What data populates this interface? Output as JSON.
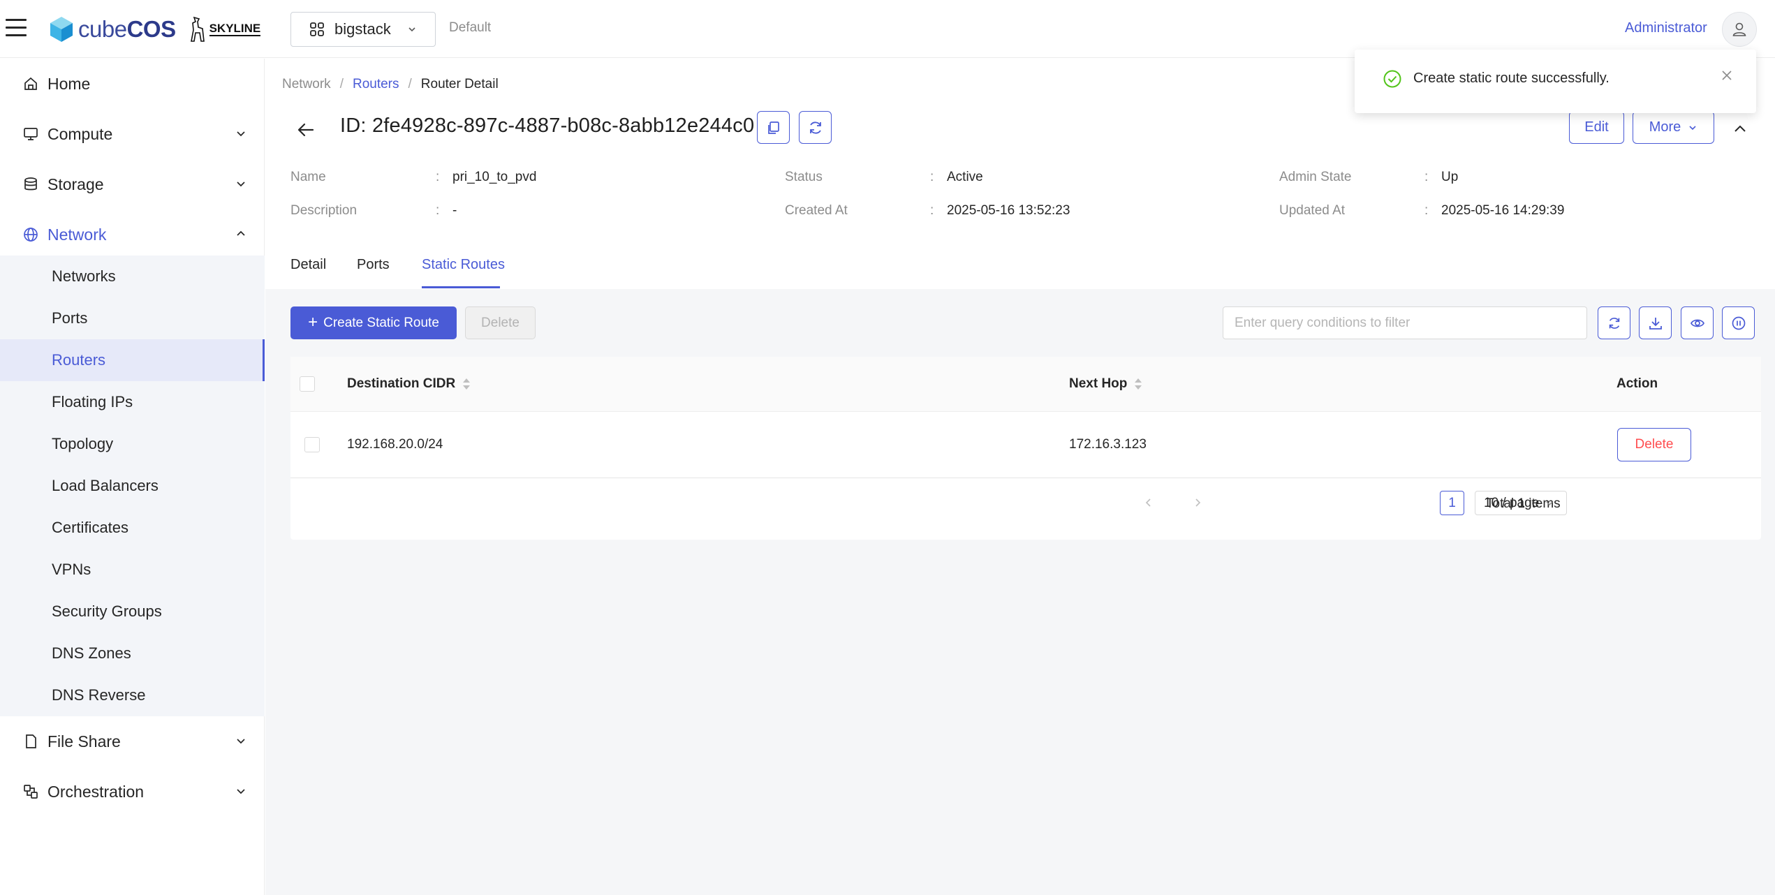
{
  "header": {
    "brand_name_light": "cube",
    "brand_name_bold": "COS",
    "partner_logo_text": "SKYLINE",
    "project": "bigstack",
    "domain": "Default",
    "user": "Administrator"
  },
  "sidebar": {
    "items": [
      {
        "label": "Home",
        "icon": "home-icon"
      },
      {
        "label": "Compute",
        "icon": "monitor-icon"
      },
      {
        "label": "Storage",
        "icon": "database-icon"
      },
      {
        "label": "Network",
        "icon": "globe-icon"
      },
      {
        "label": "File Share",
        "icon": "file-icon"
      },
      {
        "label": "Orchestration",
        "icon": "orchestration-icon"
      }
    ],
    "network_sub": [
      "Networks",
      "Ports",
      "Routers",
      "Floating IPs",
      "Topology",
      "Load Balancers",
      "Certificates",
      "VPNs",
      "Security Groups",
      "DNS Zones",
      "DNS Reverse"
    ]
  },
  "breadcrumb": {
    "items": [
      "Network",
      "Routers",
      "Router Detail"
    ]
  },
  "detail": {
    "id_label": "ID:",
    "id_value": "2fe4928c-897c-4887-b08c-8abb12e244c0",
    "edit_label": "Edit",
    "more_label": "More",
    "fields": [
      {
        "label": "Name",
        "value": "pri_10_to_pvd"
      },
      {
        "label": "Description",
        "value": "-"
      },
      {
        "label": "Status",
        "value": "Active"
      },
      {
        "label": "Created At",
        "value": "2025-05-16 13:52:23"
      },
      {
        "label": "Admin State",
        "value": "Up"
      },
      {
        "label": "Updated At",
        "value": "2025-05-16 14:29:39"
      }
    ],
    "colon": ":"
  },
  "tabs": [
    "Detail",
    "Ports",
    "Static Routes"
  ],
  "toolbar": {
    "create_label": "Create Static Route",
    "delete_label": "Delete",
    "filter_placeholder": "Enter query conditions to filter"
  },
  "table": {
    "columns": [
      "Destination CIDR",
      "Next Hop",
      "Action"
    ],
    "rows": [
      {
        "destination": "192.168.20.0/24",
        "next_hop": "172.16.3.123",
        "action": "Delete"
      }
    ],
    "total": "Total 1 items",
    "page": "1",
    "page_size": "10 / page"
  },
  "notification": {
    "message": "Create static route successfully."
  },
  "colors": {
    "accent": "#4a5bd6",
    "danger": "#ff4d4f",
    "success": "#52c41a"
  }
}
